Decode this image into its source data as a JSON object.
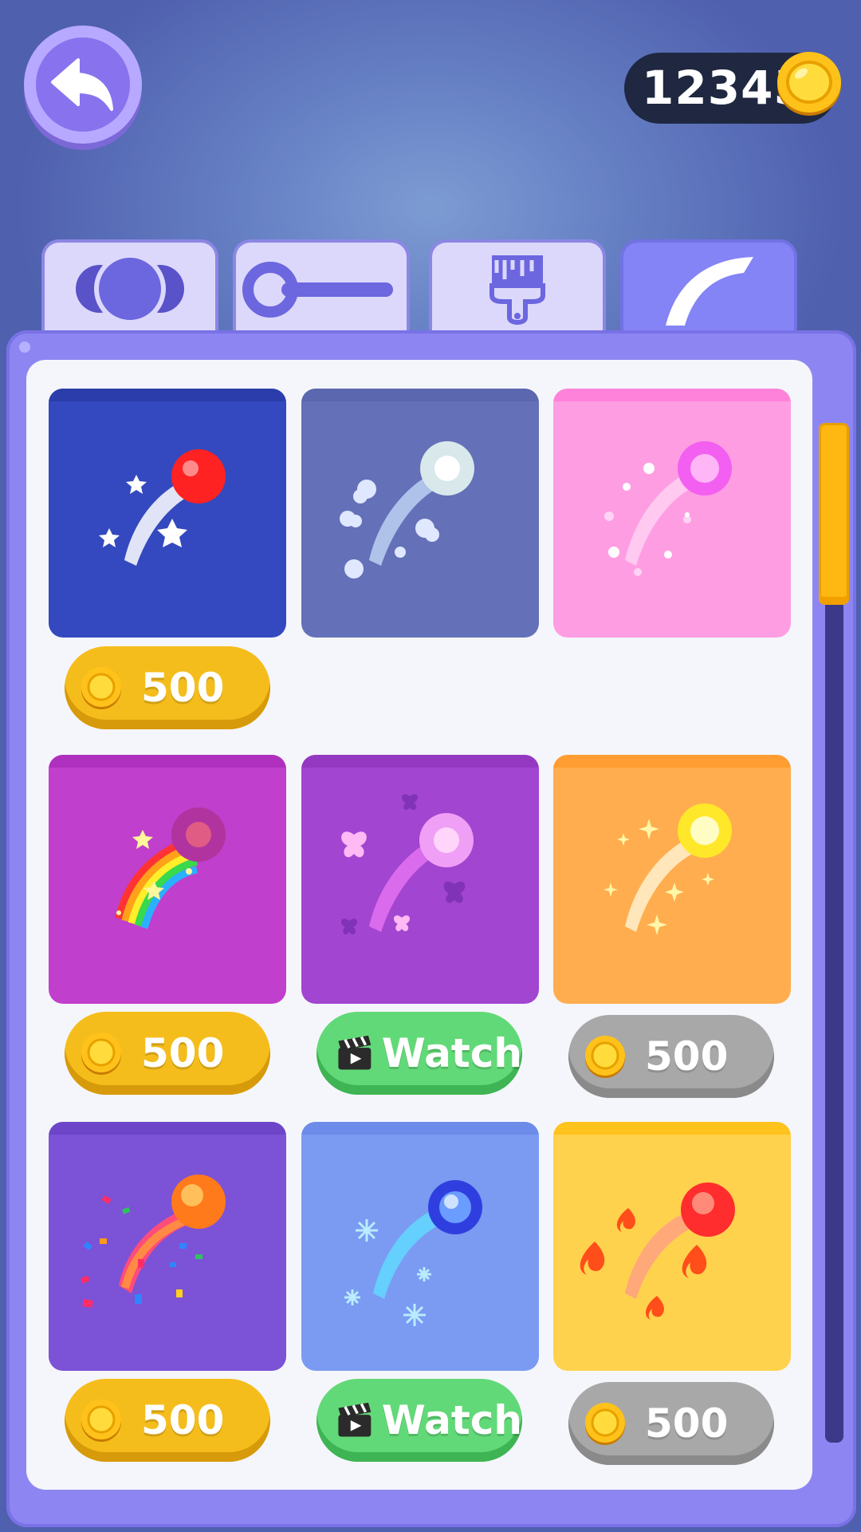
{
  "header": {
    "coins": "12345"
  },
  "tabs": [
    {
      "name": "balls-tab-icon"
    },
    {
      "name": "paddle-tab-icon"
    },
    {
      "name": "paint-brush-icon"
    },
    {
      "name": "trail-tab-icon",
      "active": true
    }
  ],
  "items": [
    {
      "label": "500",
      "style": "gold",
      "theme": "stars",
      "color": "#3449bf"
    },
    {
      "label": "",
      "style": "none",
      "theme": "clouds",
      "color": "#6470b8"
    },
    {
      "label": "",
      "style": "none",
      "theme": "bubbles",
      "color": "#ff9de3"
    },
    {
      "label": "500",
      "style": "gold",
      "theme": "rainbow",
      "color": "#c03fcc"
    },
    {
      "label": "Watch",
      "style": "green",
      "theme": "butterflies",
      "color": "#a245d0"
    },
    {
      "label": "500",
      "style": "grey",
      "theme": "sparkles",
      "color": "#ffad4e"
    },
    {
      "label": "500",
      "style": "gold",
      "theme": "confetti",
      "color": "#7c52d6"
    },
    {
      "label": "Watch",
      "style": "green",
      "theme": "snowflakes",
      "color": "#7b9af2"
    },
    {
      "label": "500",
      "style": "grey",
      "theme": "flames",
      "color": "#ffd24d"
    }
  ],
  "colors": {
    "gold_button": "#f5bd1c",
    "grey_button": "#a8a8a8",
    "green_button": "#62d978",
    "panel": "#8d86f2",
    "scroll_thumb": "#ffb712"
  }
}
